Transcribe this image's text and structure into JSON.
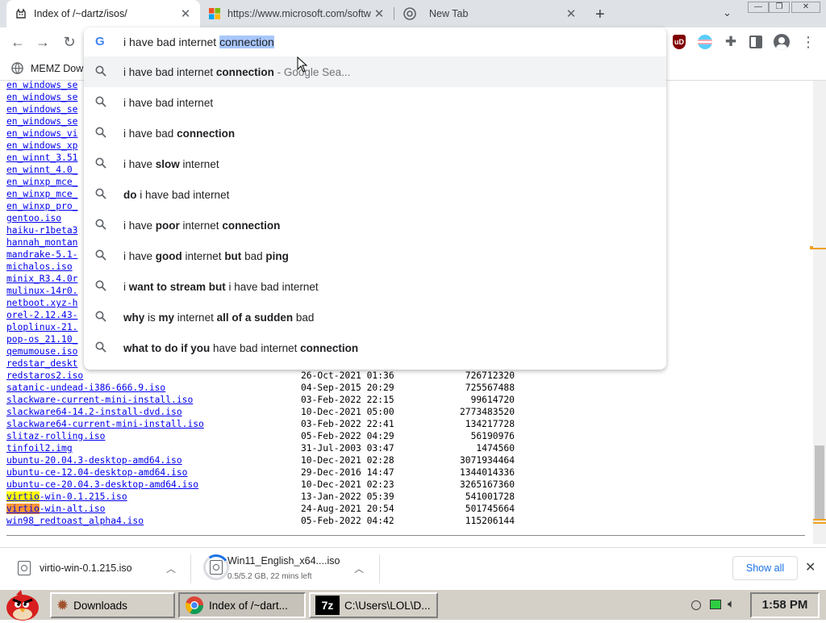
{
  "tabs": [
    {
      "title": "Index of /~dartz/isos/",
      "active": true
    },
    {
      "title": "https://www.microsoft.com/softw",
      "active": false
    },
    {
      "title": "New Tab",
      "active": false
    }
  ],
  "omnibox": {
    "typed": "i have bad internet ",
    "autocomplete": "connection",
    "suggestions": [
      {
        "parts": [
          [
            "n",
            "i have bad internet "
          ],
          [
            "b",
            "connection"
          ]
        ],
        "hint": " - Google Sea..."
      },
      {
        "parts": [
          [
            "n",
            "i have bad internet"
          ]
        ]
      },
      {
        "parts": [
          [
            "n",
            "i have bad "
          ],
          [
            "b",
            "connection"
          ]
        ]
      },
      {
        "parts": [
          [
            "n",
            "i have "
          ],
          [
            "b",
            "slow"
          ],
          [
            "n",
            " internet"
          ]
        ]
      },
      {
        "parts": [
          [
            "b",
            "do"
          ],
          [
            "n",
            " i have bad internet"
          ]
        ]
      },
      {
        "parts": [
          [
            "n",
            "i have "
          ],
          [
            "b",
            "poor"
          ],
          [
            "n",
            " internet "
          ],
          [
            "b",
            "connection"
          ]
        ]
      },
      {
        "parts": [
          [
            "n",
            "i have "
          ],
          [
            "b",
            "good"
          ],
          [
            "n",
            " internet "
          ],
          [
            "b",
            "but"
          ],
          [
            "n",
            " bad "
          ],
          [
            "b",
            "ping"
          ]
        ]
      },
      {
        "parts": [
          [
            "n",
            "i "
          ],
          [
            "b",
            "want to stream but"
          ],
          [
            "n",
            " i have bad internet"
          ]
        ]
      },
      {
        "parts": [
          [
            "b",
            "why"
          ],
          [
            "n",
            " is "
          ],
          [
            "b",
            "my"
          ],
          [
            "n",
            " internet "
          ],
          [
            "b",
            "all of a sudden"
          ],
          [
            "n",
            " bad"
          ]
        ]
      },
      {
        "parts": [
          [
            "b",
            "what to do"
          ],
          [
            "n",
            " "
          ],
          [
            "b",
            "if you"
          ],
          [
            "n",
            " have bad internet "
          ],
          [
            "b",
            "connection"
          ]
        ]
      }
    ]
  },
  "bookmark": "MEMZ Dow",
  "listing_top": [
    "en_windows_se",
    "en_windows_se",
    "en_windows_se",
    "en_windows_se",
    "en_windows_vi",
    "en_windows_xp",
    "en_winnt_3.51",
    "en_winnt_4.0_",
    "en_winxp_mce_",
    "en_winxp_mce_",
    "en_winxp_pro_",
    "gentoo.iso",
    "haiku-r1beta3",
    "hannah_montan",
    "mandrake-5.1-",
    "michalos.iso",
    "minix_R3.4.0r",
    "mulinux-14r0.",
    "netboot.xyz-h",
    "orel-2.12.43-",
    "ploplinux-21.",
    "pop-os_21.10_",
    "qemumouse.iso",
    "redstar_deskt"
  ],
  "listing": [
    {
      "name": "redstaros2.iso",
      "date": "26-Oct-2021 01:36",
      "size": "726712320"
    },
    {
      "name": "satanic-undead-i386-666.9.iso",
      "date": "04-Sep-2015 20:29",
      "size": "725567488"
    },
    {
      "name": "slackware-current-mini-install.iso",
      "date": "03-Feb-2022 22:15",
      "size": "99614720"
    },
    {
      "name": "slackware64-14.2-install-dvd.iso",
      "date": "10-Dec-2021 05:00",
      "size": "2773483520"
    },
    {
      "name": "slackware64-current-mini-install.iso",
      "date": "03-Feb-2022 22:41",
      "size": "134217728"
    },
    {
      "name": "slitaz-rolling.iso",
      "date": "05-Feb-2022 04:29",
      "size": "56190976"
    },
    {
      "name": "tinfoil2.img",
      "date": "31-Jul-2003 03:47",
      "size": "1474560"
    },
    {
      "name": "ubuntu-20.04.3-desktop-amd64.iso",
      "date": "10-Dec-2021 02:28",
      "size": "3071934464"
    },
    {
      "name": "ubuntu-ce-12.04-desktop-amd64.iso",
      "date": "29-Dec-2016 14:47",
      "size": "1344014336"
    },
    {
      "name": "ubuntu-ce-20.04.3-desktop-amd64.iso",
      "date": "10-Dec-2021 02:23",
      "size": "3265167360"
    },
    {
      "name": "-win-0.1.215.iso",
      "prefix": "virtio",
      "prefix_style": "yellow",
      "date": "13-Jan-2022 05:39",
      "size": "541001728"
    },
    {
      "name": "-win-alt.iso",
      "prefix": "virtio",
      "prefix_style": "orange",
      "date": "24-Aug-2021 20:54",
      "size": "501745664"
    },
    {
      "name": "win98_redtoast_alpha4.iso",
      "date": "05-Feb-2022 04:42",
      "size": "115206144"
    }
  ],
  "downloads": [
    {
      "name": "virtio-win-0.1.215.iso",
      "status": ""
    },
    {
      "name": "Win11_English_x64....iso",
      "status": "0.5/5.2 GB, 22 mins left"
    }
  ],
  "show_all": "Show all",
  "taskbar": {
    "buttons": [
      "Downloads",
      "Index of /~dart...",
      "C:\\Users\\LOL\\D..."
    ],
    "clock": "1:58 PM"
  }
}
